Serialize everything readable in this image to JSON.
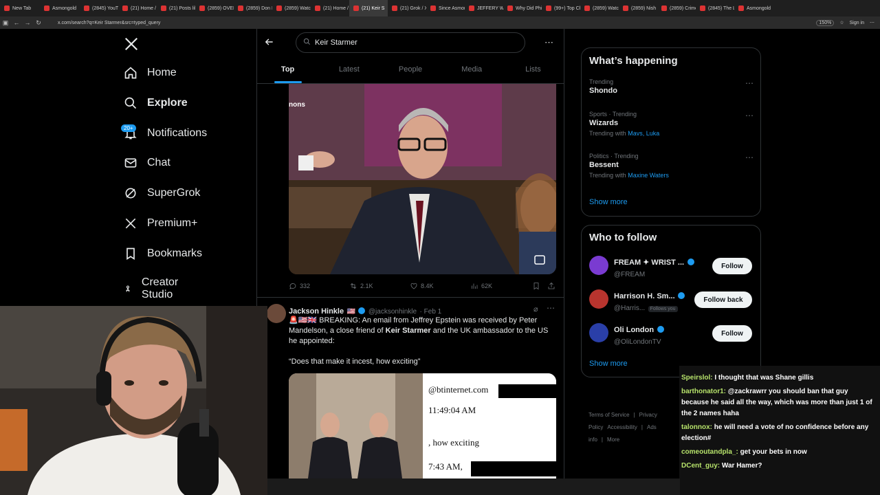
{
  "browser": {
    "tabs": [
      {
        "label": "New Tab",
        "w": 58
      },
      {
        "label": "Asmongold",
        "w": 58
      },
      {
        "label": "(2845) YouTu",
        "w": 56
      },
      {
        "label": "(21) Home /",
        "w": 56
      },
      {
        "label": "(21) Posts lik",
        "w": 56
      },
      {
        "label": "(2859) OVERF",
        "w": 56
      },
      {
        "label": "(2859) Don I.",
        "w": 56
      },
      {
        "label": "(2859) Watch",
        "w": 56
      },
      {
        "label": "(21) Home /",
        "w": 56
      },
      {
        "label": "(21) Keir S",
        "w": 56,
        "active": true
      },
      {
        "label": "(21) Grok / X",
        "w": 56
      },
      {
        "label": "Since Asmon",
        "w": 56
      },
      {
        "label": "JEFFERY WI",
        "w": 56
      },
      {
        "label": "Why Did Phi",
        "w": 56
      },
      {
        "label": "(99+) Top Ch",
        "w": 56
      },
      {
        "label": "(2859) Watch",
        "w": 56
      },
      {
        "label": "(2859) Nish",
        "w": 56
      },
      {
        "label": "(2859) Crime",
        "w": 56
      },
      {
        "label": "(2845) The L",
        "w": 56
      },
      {
        "label": "Asmongold",
        "w": 60
      }
    ],
    "url": "x.com/search?q=Keir Starmer&src=typed_query",
    "zoom": "150%",
    "sign_in": "Sign in"
  },
  "nav": {
    "items": [
      {
        "label": "Home",
        "icon": "home-icon"
      },
      {
        "label": "Explore",
        "icon": "search-icon",
        "bold": true
      },
      {
        "label": "Notifications",
        "icon": "bell-icon"
      },
      {
        "label": "Chat",
        "icon": "mail-icon"
      },
      {
        "label": "SuperGrok",
        "icon": "grok-icon"
      },
      {
        "label": "Premium+",
        "icon": "x-logo-icon"
      },
      {
        "label": "Bookmarks",
        "icon": "bookmark-icon"
      },
      {
        "label": "Creator Studio",
        "icon": "creator-studio-icon"
      }
    ],
    "notif_badge": "20+"
  },
  "search": {
    "query": "Keir Starmer",
    "tabs": [
      "Top",
      "Latest",
      "People",
      "Media",
      "Lists"
    ],
    "active_tab": "Top"
  },
  "tweet1": {
    "media_caption_fragment": "nons",
    "replies": "332",
    "reposts": "2.1K",
    "likes": "8.4K",
    "views": "62K"
  },
  "tweet2": {
    "name": "Jackson Hinkle",
    "flag": "🇺🇸",
    "handle": "@jacksonhinkle",
    "date": "· Feb 1",
    "text_prefix": "🚨🇺🇸🇬🇧 BREAKING: An email from Jeffrey Epstein was received by Peter Mandelson, a close friend of ",
    "text_bold": "Keir Starmer",
    "text_suffix": " and the UK ambassador to the US he appointed:",
    "quote": "“Does that make it incest, how exciting”",
    "doc_lines": [
      "@btinternet.com",
      "11:49:04 AM",
      ", how exciting",
      "7:43 AM,"
    ]
  },
  "happening": {
    "title": "What’s happening",
    "trends": [
      {
        "meta": "Trending",
        "name": "Shondo",
        "with_label": "",
        "with": ""
      },
      {
        "meta": "Sports · Trending",
        "name": "Wizards",
        "with_label": "Trending with",
        "with": "Mavs, Luka"
      },
      {
        "meta": "Politics · Trending",
        "name": "Bessent",
        "with_label": "Trending with",
        "with": "Maxine Waters"
      }
    ],
    "show_more": "Show more"
  },
  "who_to_follow": {
    "title": "Who to follow",
    "accounts": [
      {
        "name": "FREAM ✦ WRIST ...",
        "handle": "@FREAM",
        "button": "Follow",
        "follows_you": ""
      },
      {
        "name": "Harrison H. Sm...",
        "handle": "@Harris...",
        "button": "Follow back",
        "follows_you": "Follows you"
      },
      {
        "name": "Oli London",
        "handle": "@OliLondonTV",
        "button": "Follow",
        "follows_you": ""
      }
    ],
    "show_more": "Show more"
  },
  "footer_links": [
    "Terms of Service",
    "|",
    "Privacy Policy",
    "Accessibility",
    "|",
    "Ads info",
    "|",
    "More"
  ],
  "chat": [
    {
      "user": "Speirslol:",
      "msg": "I thought that was Shane gillis"
    },
    {
      "user": "barthonator1:",
      "msg": "@zackrawrr you should ban that guy because he said all the way, which was more than just 1 of the 2 names haha"
    },
    {
      "user": "talonnox:",
      "msg": "he will need a vote of no confidence before any election#"
    },
    {
      "user": "comeoutandpla_:",
      "msg": "get your bets in now"
    },
    {
      "user": "DCent_guy:",
      "msg": "War Hamer?"
    }
  ],
  "colors": {
    "accent": "#1d9bf0",
    "chat_user": "#b7e36b",
    "bg": "#000000"
  }
}
